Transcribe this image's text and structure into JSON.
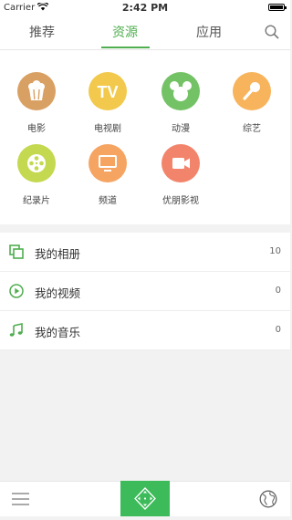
{
  "status_bar": {
    "carrier": "Carrier",
    "time": "2:42 PM"
  },
  "tabs": [
    {
      "label": "推荐",
      "active": false
    },
    {
      "label": "资源",
      "active": true
    },
    {
      "label": "应用",
      "active": false
    }
  ],
  "categories": [
    {
      "label": "电影",
      "icon": "popcorn-icon",
      "color": "#d9a063"
    },
    {
      "label": "电视剧",
      "icon": "tv-icon",
      "color": "#f2c94c",
      "icon_text": "TV"
    },
    {
      "label": "动漫",
      "icon": "mouse-head-icon",
      "color": "#74c266"
    },
    {
      "label": "综艺",
      "icon": "microphone-icon",
      "color": "#f7b45c"
    },
    {
      "label": "纪录片",
      "icon": "film-reel-icon",
      "color": "#c4d94f"
    },
    {
      "label": "频道",
      "icon": "monitor-icon",
      "color": "#f6a462"
    },
    {
      "label": "优朋影视",
      "icon": "video-camera-icon",
      "color": "#f2846b"
    }
  ],
  "media_list": [
    {
      "label": "我的相册",
      "count": "10",
      "icon": "album-icon"
    },
    {
      "label": "我的视频",
      "count": "0",
      "icon": "play-icon"
    },
    {
      "label": "我的音乐",
      "count": "0",
      "icon": "music-note-icon"
    }
  ],
  "accent_color": "#4fae4f",
  "bottom_bar": {
    "left_icon": "menu-icon",
    "center_icon": "remote-control-icon",
    "right_icon": "globe-icon"
  }
}
